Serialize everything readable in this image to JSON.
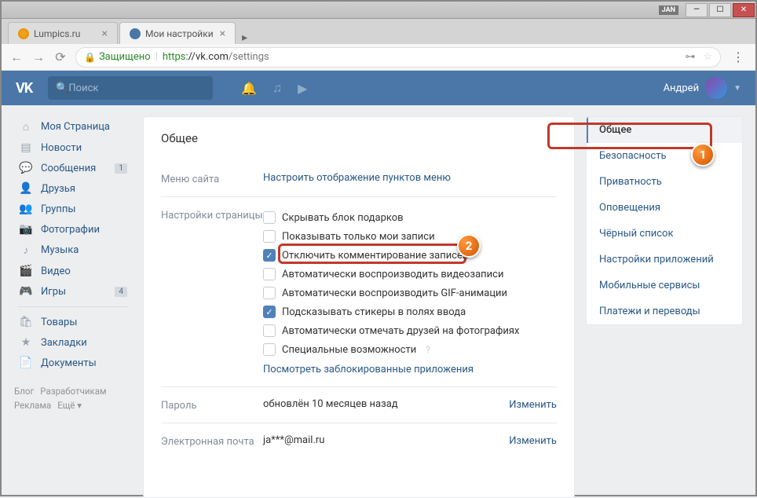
{
  "window": {
    "jan": "JAN"
  },
  "tabs": {
    "t0": "Lumpics.ru",
    "t1": "Мои настройки"
  },
  "addr": {
    "secure": "Защищено",
    "proto": "https",
    "host": "://vk.com",
    "path": "/settings"
  },
  "header": {
    "logo": "VK",
    "search_placeholder": "Поиск",
    "username": "Андрей"
  },
  "leftnav": {
    "i0": "Моя Страница",
    "i1": "Новости",
    "i2": "Сообщения",
    "b2": "1",
    "i3": "Друзья",
    "i4": "Группы",
    "i5": "Фотографии",
    "i6": "Музыка",
    "i7": "Видео",
    "i8": "Игры",
    "b8": "4",
    "i9": "Товары",
    "i10": "Закладки",
    "i11": "Документы"
  },
  "footer": {
    "f0": "Блог",
    "f1": "Разработчикам",
    "f2": "Реклама",
    "f3": "Ещё ▾"
  },
  "content": {
    "title": "Общее",
    "menu_label": "Меню сайта",
    "menu_link": "Настроить отображение пунктов меню",
    "settings_label": "Настройки страницы",
    "c0": "Скрывать блок подарков",
    "c1": "Показывать только мои записи",
    "c2": "Отключить комментирование записей",
    "c3": "Автоматически воспроизводить видеозаписи",
    "c4": "Автоматически воспроизводить GIF-анимации",
    "c5": "Подсказывать стикеры в полях ввода",
    "c6": "Автоматически отмечать друзей на фотографиях",
    "c7": "Специальные возможности",
    "blocked_link": "Посмотреть заблокированные приложения",
    "pwd_label": "Пароль",
    "pwd_value": "обновлён 10 месяцев назад",
    "email_label": "Электронная почта",
    "email_value": "ja***@mail.ru",
    "change": "Изменить"
  },
  "rtabs": {
    "r0": "Общее",
    "r1": "Безопасность",
    "r2": "Приватность",
    "r3": "Оповещения",
    "r4": "Чёрный список",
    "r5": "Настройки приложений",
    "r6": "Мобильные сервисы",
    "r7": "Платежи и переводы"
  },
  "callouts": {
    "n1": "1",
    "n2": "2"
  }
}
